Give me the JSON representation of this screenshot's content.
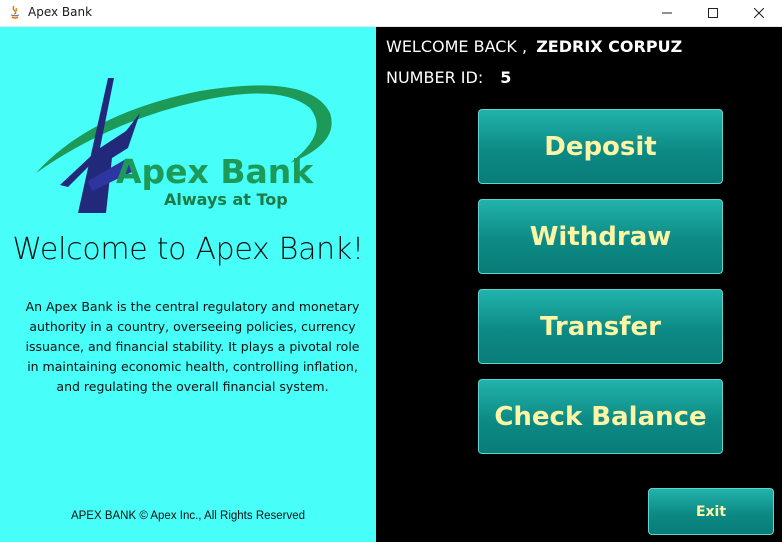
{
  "window": {
    "title": "Apex Bank",
    "controls": [
      "minimize",
      "maximize",
      "close"
    ]
  },
  "left_panel": {
    "logo": {
      "brand": "Apex Bank",
      "tagline": "Always at Top"
    },
    "heading": "Welcome to Apex Bank!",
    "about_lines": [
      "An Apex Bank is the central regulatory and monetary",
      "authority in a country, overseeing policies, currency",
      "issuance, and financial stability. It plays a pivotal role",
      "in maintaining economic health, controlling inflation,",
      "and regulating the overall financial system."
    ],
    "footer": "APEX BANK © Apex Inc., All Rights Reserved",
    "background_color": "#47fef8"
  },
  "right_panel": {
    "welcome_label": "WELCOME BACK ,",
    "user_name": "ZEDRIX CORPUZ",
    "number_id_label": "NUMBER ID:",
    "number_id_value": "5",
    "actions": {
      "deposit": "Deposit",
      "withdraw": "Withdraw",
      "transfer": "Transfer",
      "check_balance": "Check Balance"
    },
    "exit_label": "Exit",
    "button_text_color": "#fdf5a6",
    "button_color": "#0d8a85"
  }
}
